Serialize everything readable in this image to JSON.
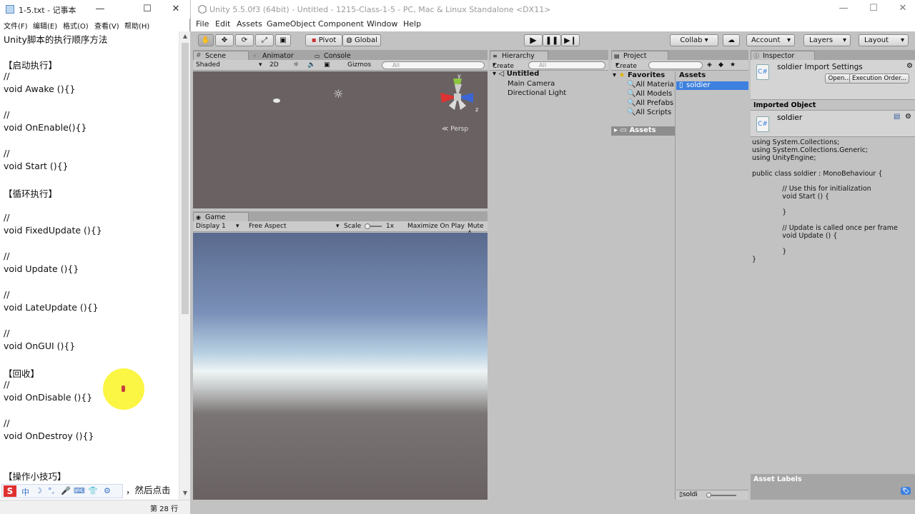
{
  "notepad": {
    "title": "1-5.txt - 记事本",
    "window_buttons": [
      "—",
      "☐",
      "✕"
    ],
    "menu": [
      "文件(F)",
      "编辑(E)",
      "格式(O)",
      "查看(V)",
      "帮助(H)"
    ],
    "lines": [
      "Unity脚本的执行顺序方法",
      "",
      "【启动执行】",
      "//",
      "void Awake (){}",
      "",
      "//",
      "void OnEnable(){}",
      "",
      "//",
      "void Start (){}",
      "",
      "【循环执行】",
      "",
      "//",
      "void FixedUpdate (){}",
      "",
      "//",
      "void Update (){}",
      "",
      "//",
      "void LateUpdate (){}",
      "",
      "//",
      "void OnGUI (){}",
      "",
      "【回收】",
      "//",
      "void OnDisable (){}",
      "",
      "//",
      "void OnDestroy (){}",
      "",
      "",
      "【操作小技巧】"
    ],
    "partial_line": "，然后点击",
    "status": "第 28 行",
    "ime": {
      "logo": "S",
      "chars": [
        "中",
        "☽",
        "°,",
        "🎤",
        "⌨",
        "👕",
        "⚙"
      ]
    }
  },
  "unity": {
    "title": "Unity 5.5.0f3 (64bit) - Untitled - 1215-Class-1-5 - PC, Mac & Linux Standalone <DX11>",
    "window_buttons": [
      "—",
      "☐",
      "✕"
    ],
    "menu": [
      "File",
      "Edit",
      "Assets",
      "GameObject",
      "Component",
      "Window",
      "Help"
    ],
    "toolbar": {
      "pivot": "Pivot",
      "global": "Global",
      "collab": "Collab ▾",
      "account": "Account",
      "layers": "Layers",
      "layout": "Layout"
    },
    "scene": {
      "tabs": [
        "Scene",
        "Animator",
        "Console"
      ],
      "shading": "Shaded",
      "mode2d": "2D",
      "gizmos": "Gizmos",
      "search": "All",
      "persp": "Persp",
      "axes": {
        "y": "y",
        "z": "z"
      }
    },
    "game": {
      "tab": "Game",
      "display": "Display 1",
      "aspect": "Free Aspect",
      "scale_label": "Scale",
      "scale_value": "1x",
      "maximize": "Maximize On Play",
      "mute": "Mute A"
    },
    "hierarchy": {
      "tab": "Hierarchy",
      "create": "Create",
      "search": "All",
      "scene_name": "Untitled",
      "items": [
        "Main Camera",
        "Directional Light"
      ]
    },
    "project": {
      "tab": "Project",
      "create": "Create",
      "favorites_label": "Favorites",
      "favorites": [
        "All Materia",
        "All Models",
        "All Prefabs",
        "All Scripts"
      ],
      "assets_root": "Assets",
      "assets_header": "Assets",
      "assets": [
        "soldier"
      ],
      "bottom_search": "soldi"
    },
    "inspector": {
      "tab": "Inspector",
      "title": "soldier Import Settings",
      "open": "Open...",
      "exec_order": "Execution Order...",
      "imported_object": "Imported Object",
      "object_name": "soldier",
      "code": "using System.Collections;\nusing System.Collections.Generic;\nusing UnityEngine;\n\npublic class soldier : MonoBehaviour {\n\n              // Use this for initialization\n              void Start () {\n\n              }\n\n              // Update is called once per frame\n              void Update () {\n\n              }\n}",
      "asset_labels": "Asset Labels"
    },
    "colors": {
      "panel": "#c2c2c2",
      "scene_bg": "#6a6262",
      "selection": "#3d80df"
    }
  }
}
